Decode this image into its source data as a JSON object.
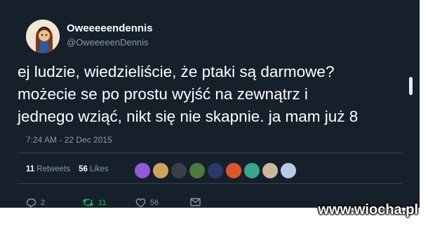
{
  "tweet": {
    "display_name": "Oweeeeendennis",
    "handle": "@OweeeeenDennis",
    "text_lines": [
      "ej ludzie, wiedzieliście, że ptaki są darmowe?",
      "możecie se po prostu wyjść na zewnątrz i",
      "jednego wziąć, nikt się nie skapnie. ja mam już 8"
    ],
    "timestamp": "7:24 AM - 22 Dec 2015",
    "stats": {
      "retweets_count": "11",
      "retweets_label": "Retweets",
      "likes_count": "56",
      "likes_label": "Likes"
    },
    "likers": [
      {
        "color": "#8f5bd6"
      },
      {
        "color": "#d2a25c"
      },
      {
        "color": "#3a3f45"
      },
      {
        "color": "#4c7a3c"
      },
      {
        "color": "#2b3a6b"
      },
      {
        "color": "#e0562b"
      },
      {
        "color": "#39a58d"
      },
      {
        "color": "#c9b89a"
      },
      {
        "color": "#b8c9e6"
      }
    ],
    "actions": {
      "reply_count": "2",
      "retweet_count": "11",
      "like_count": "56"
    }
  },
  "watermark": "www.wiocha.pl",
  "colors": {
    "background": "#15202b",
    "text": "#ffffff",
    "muted": "#8899a6",
    "retweet": "#17bf63"
  },
  "icons": [
    "reply-icon",
    "retweet-icon",
    "like-icon",
    "message-icon"
  ]
}
